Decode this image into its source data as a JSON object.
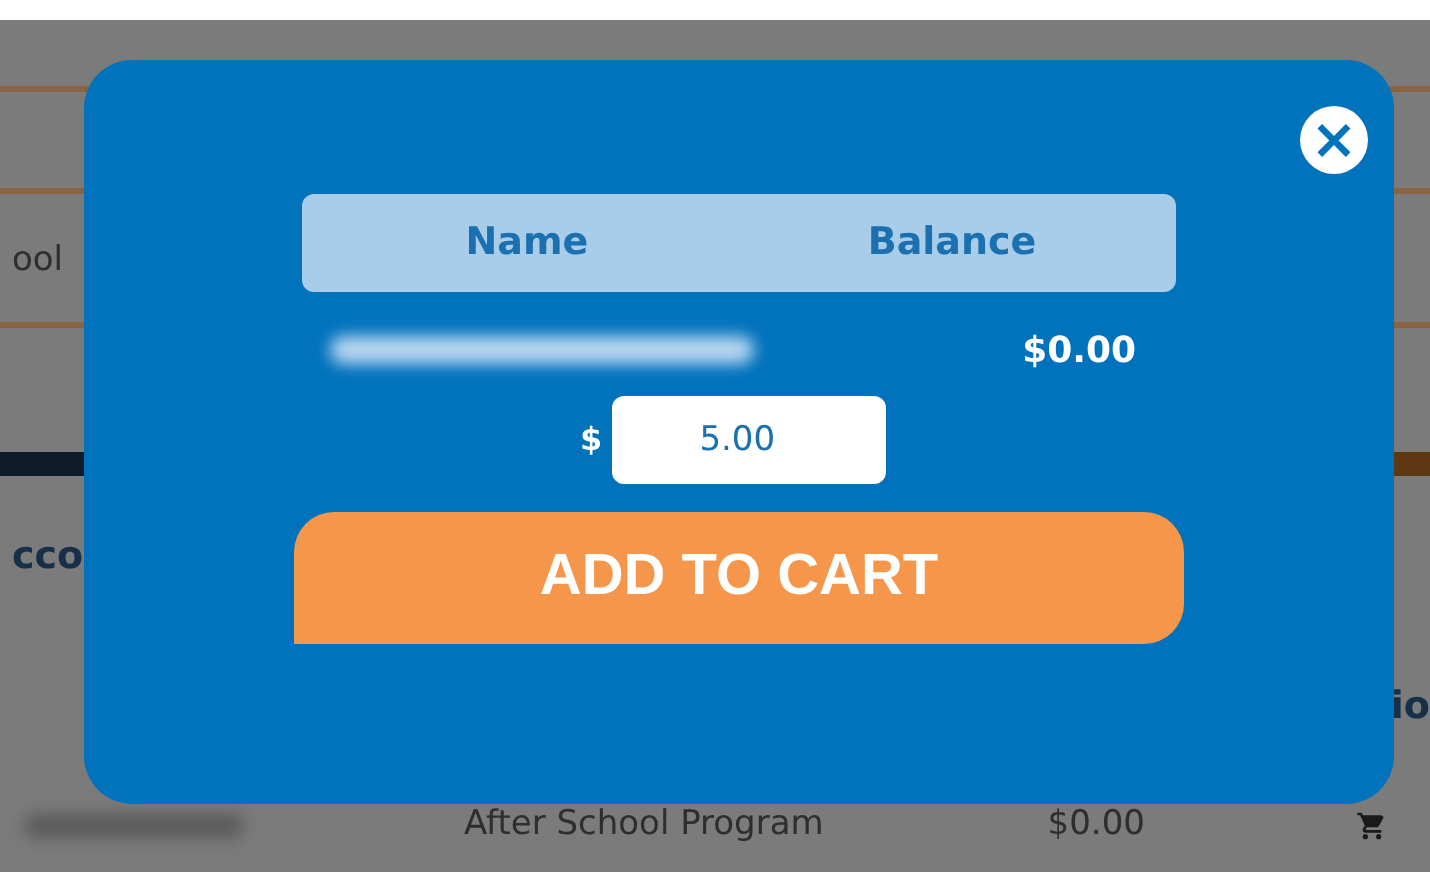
{
  "background": {
    "texts": [
      {
        "kind": "plain",
        "text": "ool"
      },
      {
        "kind": "heading",
        "text": "cco"
      },
      {
        "kind": "heading",
        "text": "io"
      }
    ],
    "row": {
      "program": "After School Program",
      "amount": "$0.00"
    }
  },
  "dialog": {
    "close": "×",
    "columns": [
      "Name",
      "Balance"
    ],
    "balance": "$0.00",
    "currency": "$",
    "amount": "5.00",
    "button": "ADD TO CART"
  }
}
